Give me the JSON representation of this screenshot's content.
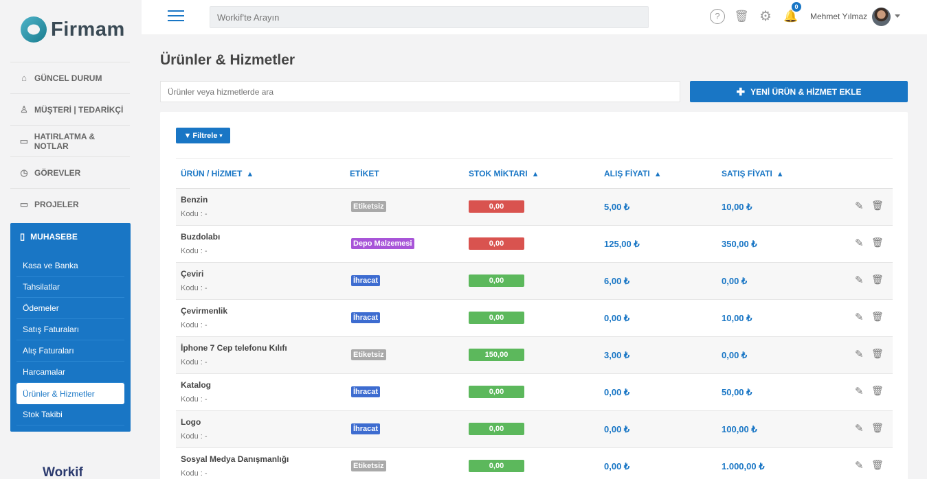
{
  "brand": {
    "logo_text": "Firmam",
    "footer_logo": "Workif"
  },
  "sidebar": {
    "items": [
      {
        "label": "GÜNCEL DURUM",
        "icon": "home-icon"
      },
      {
        "label": "MÜŞTERİ | TEDARİKÇİ",
        "icon": "user-icon"
      },
      {
        "label": "HATIRLATMA & NOTLAR",
        "icon": "briefcase-icon"
      },
      {
        "label": "GÖREVLER",
        "icon": "clock-icon"
      },
      {
        "label": "PROJELER",
        "icon": "folder-icon"
      }
    ],
    "muhasebe": {
      "label": "MUHASEBE",
      "icon": "document-icon",
      "items": [
        "Kasa ve Banka",
        "Tahsilatlar",
        "Ödemeler",
        "Satış Faturaları",
        "Alış Faturaları",
        "Harcamalar",
        "Ürünler & Hizmetler",
        "Stok Takibi"
      ],
      "active": "Ürünler & Hizmetler"
    }
  },
  "topbar": {
    "search_placeholder": "Workif'te Arayın",
    "notification_count": "0",
    "user_name": "Mehmet Yılmaz"
  },
  "main": {
    "title": "Ürünler & Hizmetler",
    "search_placeholder": "Ürünler veya hizmetlerde ara",
    "add_button": "YENİ ÜRÜN & HİZMET EKLE",
    "filter_button": "Filtrele"
  },
  "table": {
    "headers": {
      "name": "ÜRÜN / HİZMET",
      "tag": "ETİKET",
      "stock": "STOK MİKTARI",
      "buy": "ALIŞ FİYATI",
      "sell": "SATIŞ FİYATI"
    },
    "rows": [
      {
        "name": "Benzin",
        "code": "Kodu : -",
        "tag": "Etiketsiz",
        "tag_color": "#a9a9a9",
        "stock": "0,00",
        "stock_color": "#d9534f",
        "buy": "5,00 ₺",
        "sell": "10,00 ₺"
      },
      {
        "name": "Buzdolabı",
        "code": "Kodu : -",
        "tag": "Depo Malzemesi",
        "tag_color": "#a855d8",
        "stock": "0,00",
        "stock_color": "#d9534f",
        "buy": "125,00 ₺",
        "sell": "350,00 ₺"
      },
      {
        "name": "Çeviri",
        "code": "Kodu : -",
        "tag": "İhracat",
        "tag_color": "#3d6cd0",
        "stock": "0,00",
        "stock_color": "#5cb85c",
        "buy": "6,00 ₺",
        "sell": "0,00 ₺"
      },
      {
        "name": "Çevirmenlik",
        "code": "Kodu : -",
        "tag": "İhracat",
        "tag_color": "#3d6cd0",
        "stock": "0,00",
        "stock_color": "#5cb85c",
        "buy": "0,00 ₺",
        "sell": "10,00 ₺"
      },
      {
        "name": "İphone 7 Cep telefonu Kılıfı",
        "code": "Kodu : -",
        "tag": "Etiketsiz",
        "tag_color": "#a9a9a9",
        "stock": "150,00",
        "stock_color": "#5cb85c",
        "buy": "3,00 ₺",
        "sell": "0,00 ₺"
      },
      {
        "name": "Katalog",
        "code": "Kodu : -",
        "tag": "İhracat",
        "tag_color": "#3d6cd0",
        "stock": "0,00",
        "stock_color": "#5cb85c",
        "buy": "0,00 ₺",
        "sell": "50,00 ₺"
      },
      {
        "name": "Logo",
        "code": "Kodu : -",
        "tag": "İhracat",
        "tag_color": "#3d6cd0",
        "stock": "0,00",
        "stock_color": "#5cb85c",
        "buy": "0,00 ₺",
        "sell": "100,00 ₺"
      },
      {
        "name": "Sosyal Medya Danışmanlığı",
        "code": "Kodu : -",
        "tag": "Etiketsiz",
        "tag_color": "#a9a9a9",
        "stock": "0,00",
        "stock_color": "#5cb85c",
        "buy": "0,00 ₺",
        "sell": "1.000,00 ₺"
      }
    ]
  }
}
